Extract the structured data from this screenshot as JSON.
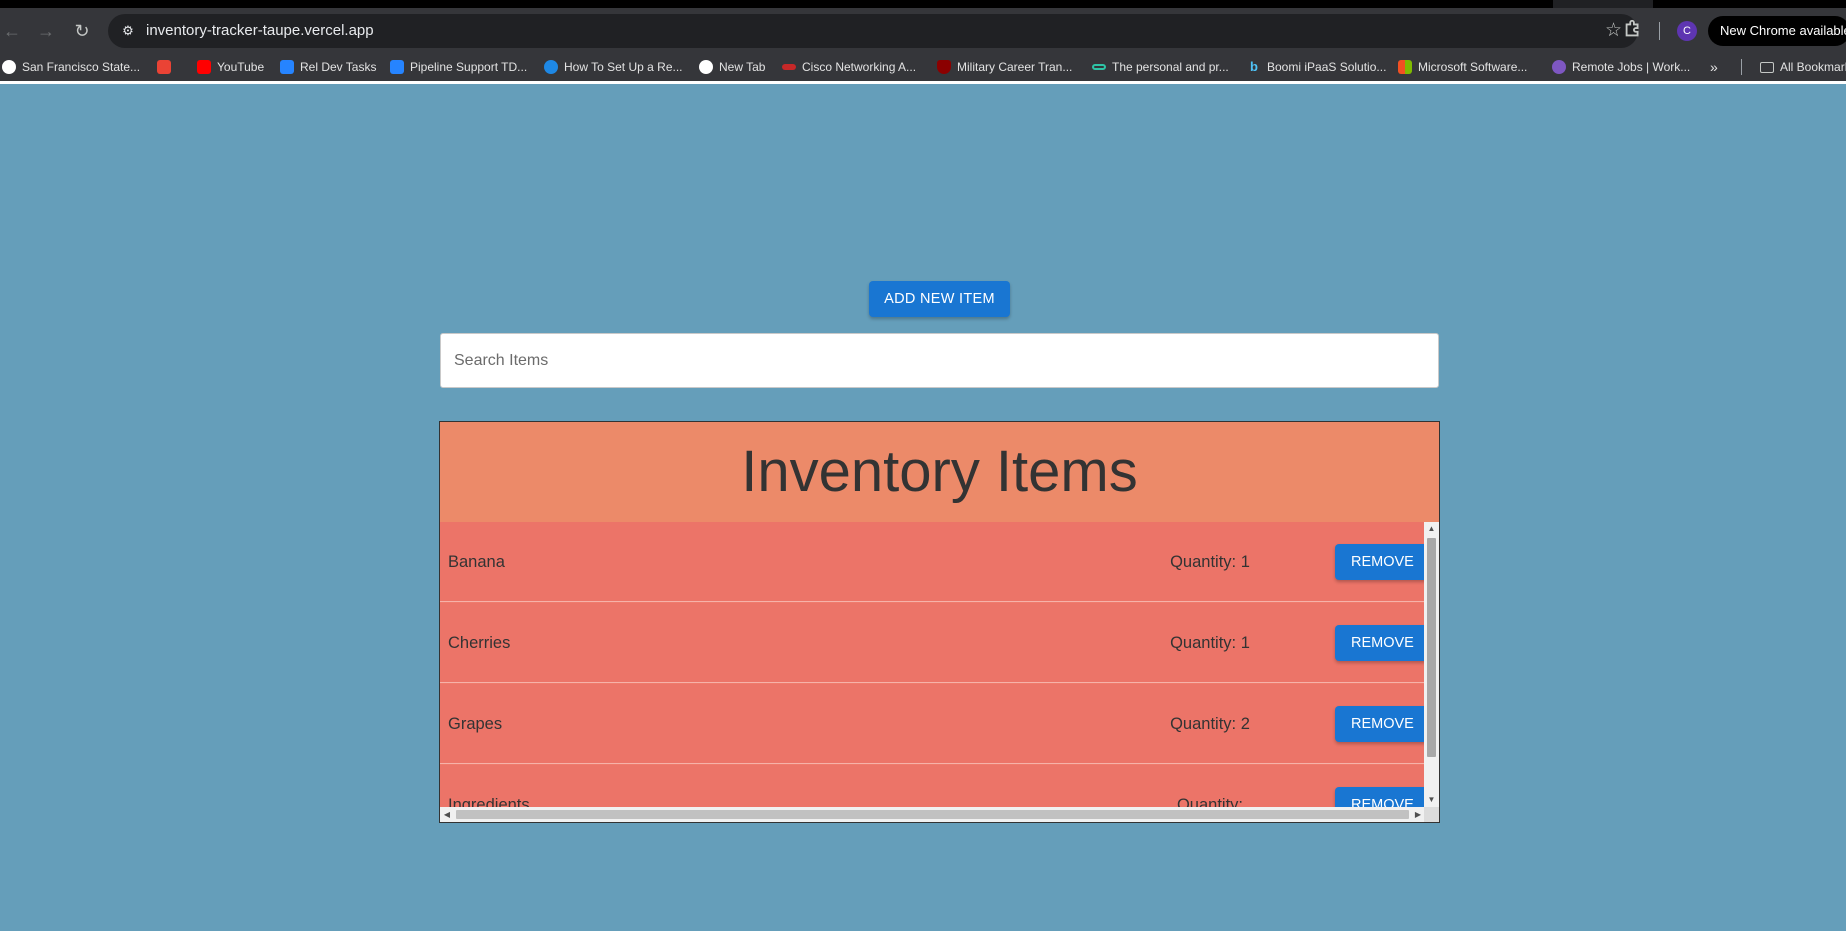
{
  "browser": {
    "url": "inventory-tracker-taupe.vercel.app",
    "update_label": "New Chrome available",
    "profile_initial": "C",
    "bookmarks": [
      {
        "label": "San Francisco State...",
        "color": "#ffffff"
      },
      {
        "label": "",
        "color": "#ea4335"
      },
      {
        "label": "YouTube",
        "color": "#ff0000"
      },
      {
        "label": "Rel Dev Tasks",
        "color": "#2684ff"
      },
      {
        "label": "Pipeline Support TD...",
        "color": "#2684ff"
      },
      {
        "label": "How To Set Up a Re...",
        "color": "#1e88e5"
      },
      {
        "label": "New Tab",
        "color": "#ffffff"
      },
      {
        "label": "Cisco Networking A...",
        "color": "#c62828"
      },
      {
        "label": "Military Career Tran...",
        "color": "#8b0000"
      },
      {
        "label": "The personal and pr...",
        "color": "#2ec4a6"
      },
      {
        "label": "Boomi iPaaS Solutio...",
        "color": "#4fc3f7"
      },
      {
        "label": "Microsoft Software...",
        "color": "#f25022"
      },
      {
        "label": "Remote Jobs | Work...",
        "color": "#7e57c2"
      }
    ],
    "more_bookmarks": "»",
    "all_bookmarks_label": "All Bookmarks"
  },
  "page": {
    "add_button_label": "ADD NEW ITEM",
    "search_placeholder": "Search Items",
    "search_value": "",
    "panel_title": "Inventory Items",
    "remove_label": "REMOVE",
    "items": [
      {
        "name": "Banana",
        "quantity_text": "Quantity: 1"
      },
      {
        "name": "Cherries",
        "quantity_text": "Quantity: 1"
      },
      {
        "name": "Grapes",
        "quantity_text": "Quantity: 2"
      },
      {
        "name": "Ingredients",
        "quantity_text": "Quantity:"
      }
    ]
  },
  "colors": {
    "page_background": "#659eba",
    "header_background": "#ec8a69",
    "row_background": "#ec7468",
    "button_blue": "#1976d2"
  }
}
